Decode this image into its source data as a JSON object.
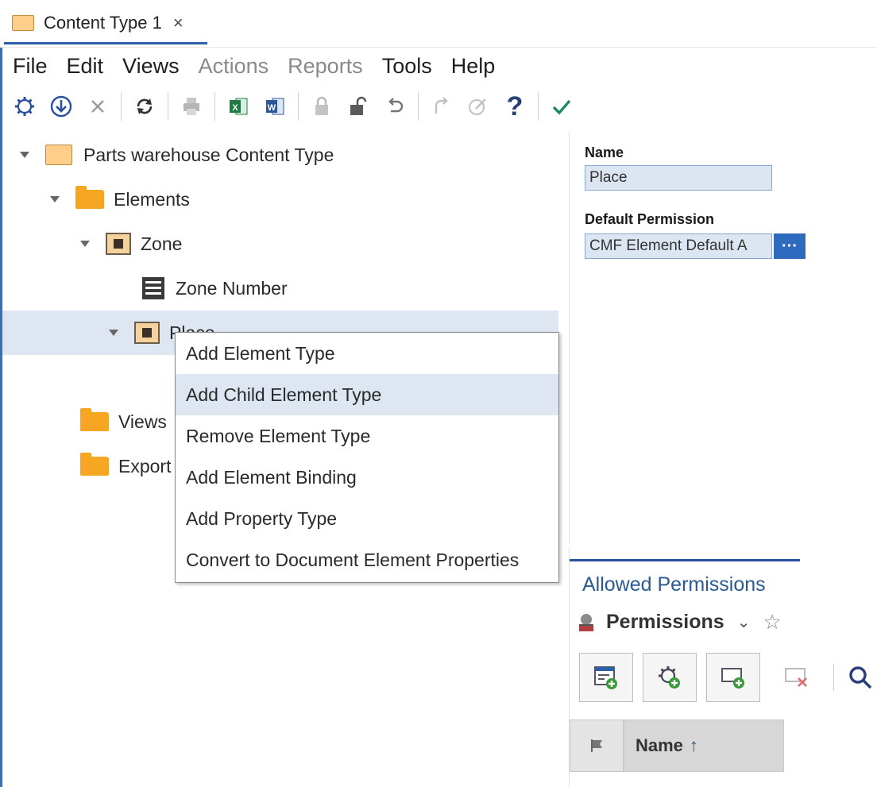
{
  "tab": {
    "label": "Content Type 1",
    "close": "×"
  },
  "menubar": {
    "items": [
      {
        "label": "File",
        "enabled": true
      },
      {
        "label": "Edit",
        "enabled": true
      },
      {
        "label": "Views",
        "enabled": true
      },
      {
        "label": "Actions",
        "enabled": false
      },
      {
        "label": "Reports",
        "enabled": false
      },
      {
        "label": "Tools",
        "enabled": true
      },
      {
        "label": "Help",
        "enabled": true
      }
    ]
  },
  "toolbar": {
    "help_glyph": "?",
    "icons": [
      "gear-icon",
      "download-icon",
      "close-icon",
      "refresh-icon",
      "print-icon",
      "excel-icon",
      "word-icon",
      "lock-icon",
      "unlock-icon",
      "undo-icon",
      "redo-icon",
      "edit-check-icon",
      "help-icon",
      "checkmark-icon"
    ]
  },
  "tree": {
    "root": "Parts warehouse Content Type",
    "elements": "Elements",
    "zone": "Zone",
    "zone_number": "Zone Number",
    "place": "Place",
    "views": "Views",
    "export": "Export"
  },
  "context_menu": {
    "items": [
      "Add Element Type",
      "Add Child Element Type",
      "Remove Element Type",
      "Add Element Binding",
      "Add Property Type",
      "Convert to Document Element Properties"
    ],
    "highlighted_index": 1
  },
  "properties": {
    "name_label": "Name",
    "name_value": "Place",
    "default_permission_label": "Default Permission",
    "default_permission_value": "CMF Element Default A",
    "browse_button": "···"
  },
  "allowed_permissions": {
    "title": "Allowed Permissions",
    "sub_label": "Permissions",
    "chevron": "⌄",
    "star": "☆",
    "grid": {
      "name_header": "Name",
      "sort_arrow": "↑"
    }
  },
  "colors": {
    "accent": "#2b5fa8",
    "folder": "#f6a623",
    "selection": "#dde6f1",
    "content_type_icon": "#ffcf8a"
  }
}
